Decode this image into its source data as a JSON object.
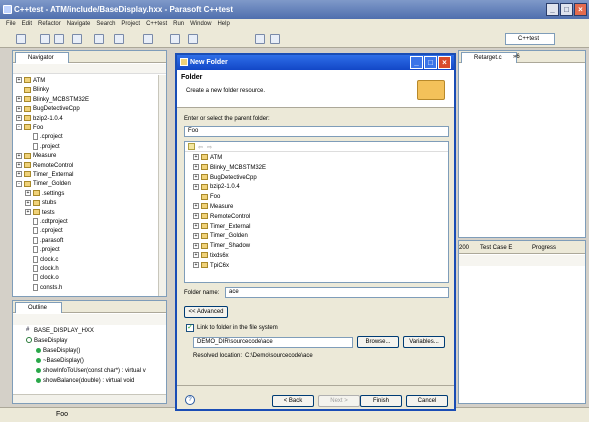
{
  "window": {
    "title": "C++test - ATM/include/BaseDisplay.hxx - Parasoft C++test"
  },
  "menu": [
    "File",
    "Edit",
    "Refactor",
    "Navigate",
    "Search",
    "Project",
    "C++test",
    "Run",
    "Window",
    "Help"
  ],
  "perspective": "C++test",
  "navigator": {
    "tab": "Navigator",
    "items": [
      {
        "label": "ATM",
        "expand": "+",
        "level": 0,
        "icon": "project"
      },
      {
        "label": "Blinky",
        "expand": "",
        "level": 0,
        "icon": "project"
      },
      {
        "label": "Blinky_MCBSTM32E",
        "expand": "+",
        "level": 0,
        "icon": "project"
      },
      {
        "label": "BugDetectiveCpp",
        "expand": "+",
        "level": 0,
        "icon": "project"
      },
      {
        "label": "bzip2-1.0.4",
        "expand": "+",
        "level": 0,
        "icon": "project"
      },
      {
        "label": "Foo",
        "expand": "-",
        "level": 0,
        "icon": "project"
      },
      {
        "label": ".cproject",
        "expand": "",
        "level": 1,
        "icon": "file"
      },
      {
        "label": ".project",
        "expand": "",
        "level": 1,
        "icon": "file"
      },
      {
        "label": "Measure",
        "expand": "+",
        "level": 0,
        "icon": "project"
      },
      {
        "label": "RemoteControl",
        "expand": "+",
        "level": 0,
        "icon": "project"
      },
      {
        "label": "Timer_External",
        "expand": "+",
        "level": 0,
        "icon": "project"
      },
      {
        "label": "Timer_Golden",
        "expand": "-",
        "level": 0,
        "icon": "project"
      },
      {
        "label": ".settings",
        "expand": "+",
        "level": 1,
        "icon": "folder"
      },
      {
        "label": "stubs",
        "expand": "+",
        "level": 1,
        "icon": "folder"
      },
      {
        "label": "tests",
        "expand": "+",
        "level": 1,
        "icon": "folder"
      },
      {
        "label": ".cdtproject",
        "expand": "",
        "level": 1,
        "icon": "file"
      },
      {
        "label": ".cproject",
        "expand": "",
        "level": 1,
        "icon": "file"
      },
      {
        "label": ".parasoft",
        "expand": "",
        "level": 1,
        "icon": "file"
      },
      {
        "label": ".project",
        "expand": "",
        "level": 1,
        "icon": "file"
      },
      {
        "label": "clock.c",
        "expand": "",
        "level": 1,
        "icon": "file"
      },
      {
        "label": "clock.h",
        "expand": "",
        "level": 1,
        "icon": "file"
      },
      {
        "label": "clock.o",
        "expand": "",
        "level": 1,
        "icon": "file"
      },
      {
        "label": "consts.h",
        "expand": "",
        "level": 1,
        "icon": "file"
      }
    ]
  },
  "outline": {
    "tab": "Outline",
    "items": [
      {
        "label": "BASE_DISPLAY_HXX",
        "level": 1,
        "icon": "hash"
      },
      {
        "label": "BaseDisplay",
        "level": 1,
        "icon": "class"
      },
      {
        "label": "BaseDisplay()",
        "level": 2,
        "icon": "method"
      },
      {
        "label": "~BaseDisplay()",
        "level": 2,
        "icon": "method"
      },
      {
        "label": "showInfoToUser(const char*) : virtual v",
        "level": 2,
        "icon": "method"
      },
      {
        "label": "showBalance(double) : virtual void",
        "level": 2,
        "icon": "method"
      }
    ]
  },
  "editor": {
    "tab": "Retarget.c",
    "overflow": "»6"
  },
  "bottom_right": {
    "tabs": [
      "200",
      "Test Case E",
      "Progress"
    ]
  },
  "status_bar": {
    "text": "Foo"
  },
  "dialog": {
    "title": "New Folder",
    "heading": "Folder",
    "description": "Create a new folder resource.",
    "parent_label": "Enter or select the parent folder:",
    "parent_value": "Foo",
    "tree": [
      "ATM",
      "Blinky_MCBSTM32E",
      "BugDetectiveCpp",
      "bzip2-1.0.4",
      "Foo",
      "Measure",
      "RemoteControl",
      "Timer_External",
      "Timer_Golden",
      "Timer_Shadow",
      "tixds6x",
      "TpiC6x"
    ],
    "tree_expand": [
      "+",
      "+",
      "+",
      "+",
      "",
      "+",
      "+",
      "+",
      "+",
      "+",
      "+",
      "+"
    ],
    "folder_name_label": "Folder name:",
    "folder_name_value": "ace",
    "advanced_button": "<< Advanced",
    "link_checkbox_label": "Link to folder in the file system",
    "link_checked": true,
    "link_path": "DEMO_DIR\\sourcecode\\ace",
    "browse_button": "Browse...",
    "variables_button": "Variables...",
    "resolved_label": "Resolved location:",
    "resolved_value": "C:\\Demo\\sourcecode\\ace",
    "help_icon": "?",
    "back_button": "< Back",
    "next_button": "Next >",
    "finish_button": "Finish",
    "cancel_button": "Cancel"
  }
}
